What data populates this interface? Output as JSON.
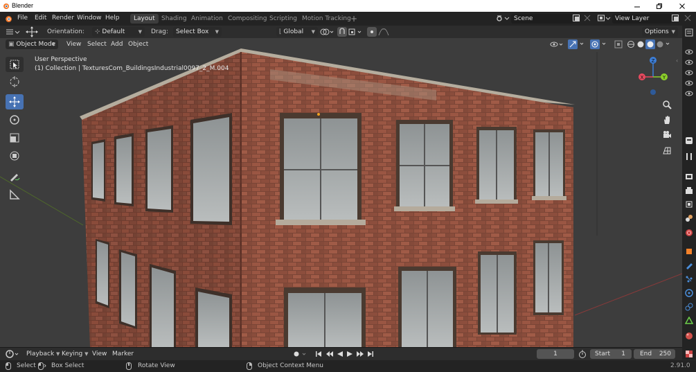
{
  "window": {
    "title": "Blender"
  },
  "menu": {
    "items": [
      "File",
      "Edit",
      "Render",
      "Window",
      "Help"
    ],
    "workspaces": [
      "Layout",
      "Shading",
      "Animation",
      "Compositing",
      "Scripting",
      "Motion Tracking"
    ],
    "add_workspace": "+",
    "scene": "Scene",
    "view_layer": "View Layer"
  },
  "toolheader": {
    "orientation_label": "Orientation:",
    "orientation_value": "Default",
    "drag_label": "Drag:",
    "drag_value": "Select Box",
    "transform_orientation": "Global",
    "options": "Options"
  },
  "viewport": {
    "mode": "Object Mode",
    "menus": [
      "View",
      "Select",
      "Add",
      "Object"
    ],
    "perspective": "User Perspective",
    "collection_info": "(1) Collection | TexturesCom_BuildingsIndustrial0097_2_M.004"
  },
  "timeline": {
    "menus": [
      "Playback",
      "Keying",
      "View",
      "Marker"
    ],
    "current_frame": "1",
    "start_label": "Start",
    "start_value": "1",
    "end_label": "End",
    "end_value": "250"
  },
  "status": {
    "select": "Select",
    "box_select": "Box Select",
    "rotate_view": "Rotate View",
    "context_menu": "Object Context Menu",
    "version": "2.91.0"
  },
  "colors": {
    "accent": "#4772b3",
    "axis_x": "#e84a5f",
    "axis_y": "#8ccf2a",
    "axis_z": "#3d7fd9",
    "brick": "#8a4a3a"
  }
}
